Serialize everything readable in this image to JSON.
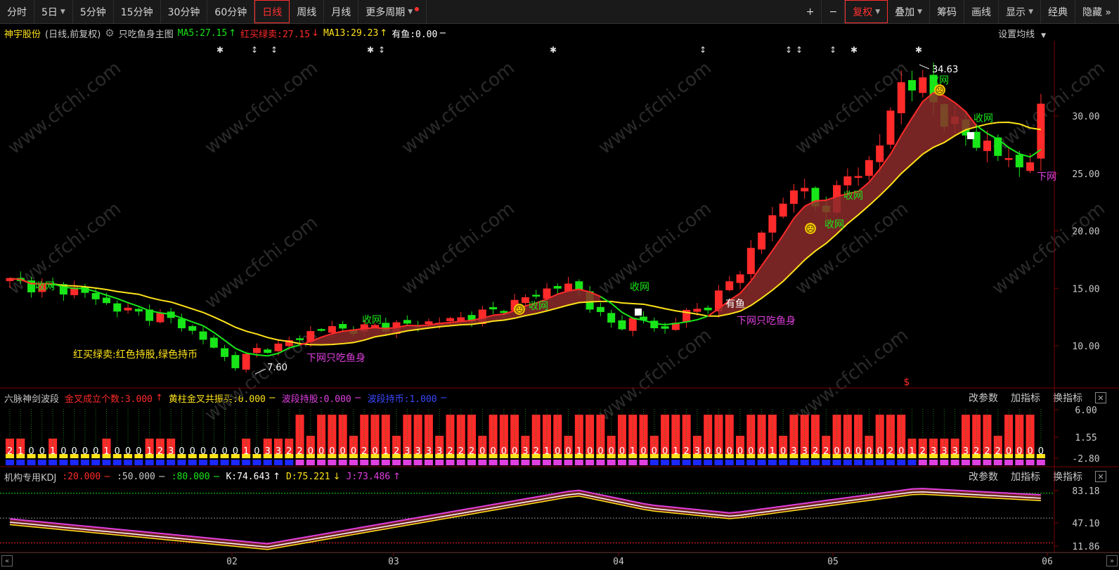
{
  "toolbar": {
    "left": [
      {
        "label": "分时"
      },
      {
        "label": "5日",
        "dropdown": true
      },
      {
        "label": "5分钟"
      },
      {
        "label": "15分钟"
      },
      {
        "label": "30分钟"
      },
      {
        "label": "60分钟"
      },
      {
        "label": "日线",
        "active": true
      },
      {
        "label": "周线"
      },
      {
        "label": "月线"
      },
      {
        "label": "更多周期",
        "dropdown": true,
        "dot": true
      }
    ],
    "right": [
      {
        "label": "+"
      },
      {
        "label": "−"
      },
      {
        "label": "复权",
        "dropdown": true,
        "active": true
      },
      {
        "label": "叠加",
        "dropdown": true
      },
      {
        "label": "筹码"
      },
      {
        "label": "画线"
      },
      {
        "label": "显示",
        "dropdown": true
      },
      {
        "label": "经典"
      },
      {
        "label": "隐藏 »"
      }
    ]
  },
  "main_header": {
    "stock_name": "神宇股份",
    "period_info": "(日线,前复权)",
    "settings_icon": "gear-icon",
    "indicator_name": "只吃鱼身主图",
    "ma5": "MA5:27.15",
    "ma5_arrow": "↑",
    "hmlm": "红买绿卖:27.15",
    "hmlm_arrow": "↓",
    "ma13": "MA13:29.23",
    "ma13_arrow": "↑",
    "youyu": "有鱼:0.00",
    "youyu_dash": "−",
    "set_ma": "设置均线"
  },
  "main_annotations": {
    "legend_text": "红买绿卖:红色持股,绿色持币",
    "high_label": "34.63",
    "low_label": "7.60",
    "shouwang": "收网",
    "xiawang": "下网只吃鱼身",
    "xiawang_short": "下网",
    "youyu_label": "有鱼",
    "s_mark": "$",
    "star_mark": "✱",
    "updown_mark": "↕",
    "face_mark": "☹"
  },
  "pane2_header": {
    "name": "六脉神剑波段",
    "jinjiao": "金叉成立个数:3.000",
    "jinjiao_arrow": "↑",
    "huangzhu": "黄柱金叉共振买:0.000",
    "huangzhu_dash": "−",
    "bodu_chigu": "波段持股:0.000",
    "bodu_chigu_dash": "−",
    "bodu_chibi": "波段持币:1.000",
    "bodu_chibi_dash": "−"
  },
  "pane3_header": {
    "name": "机构专用KDJ",
    "l20": ":20.000",
    "l20_dash": "−",
    "l50": ":50.000",
    "l50_dash": "−",
    "l80": ":80.000",
    "l80_dash": "−",
    "k": "K:74.643",
    "k_arrow": "↑",
    "d": "D:75.221",
    "d_arrow": "↓",
    "j": "J:73.486",
    "j_arrow": "↑"
  },
  "pane_actions": {
    "change_params": "改参数",
    "add_indicator": "加指标",
    "switch_indicator": "换指标",
    "close": "✕"
  },
  "y_axis_main": [
    "30.00",
    "25.00",
    "20.00",
    "15.00",
    "10.00"
  ],
  "y_axis_pane2": [
    "6.00",
    "1.55",
    "-2.80"
  ],
  "y_axis_pane3": [
    "83.18",
    "47.10",
    "11.86"
  ],
  "x_axis": [
    "02",
    "03",
    "04",
    "05",
    "06"
  ],
  "pane2_digits": "2100100001000123000000103322000002012333322200003",
  "colors": {
    "up": "#ff2a2a",
    "down": "#19e619",
    "ma_yellow": "#ffe31a",
    "magenta": "#e040e0",
    "blue": "#1c28ff",
    "band": "#8c2a2a",
    "axis_line": "#7a0000"
  },
  "watermark": "www.cfchi.com"
}
